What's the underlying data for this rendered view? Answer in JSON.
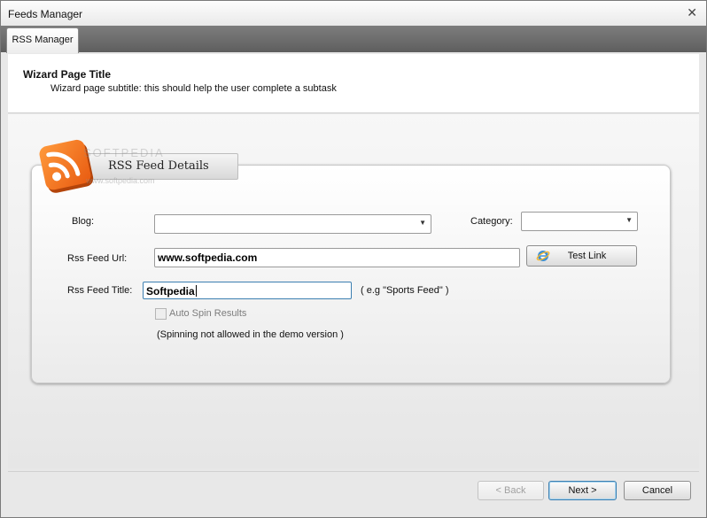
{
  "window": {
    "title": "Feeds Manager",
    "close_glyph": "✕"
  },
  "tabs": [
    {
      "label": "RSS Manager"
    }
  ],
  "header": {
    "title": "Wizard Page Title",
    "subtitle": "Wizard page subtitle: this should help the user complete a subtask"
  },
  "panel": {
    "badge_title": "RSS Feed Details",
    "watermark": "SOFTPEDIA",
    "watermark_url": "www.softpedia.com",
    "icon": "rss-icon",
    "fields": {
      "blog": {
        "label": "Blog:",
        "value": ""
      },
      "category": {
        "label": "Category:",
        "value": ""
      },
      "feed_url": {
        "label": "Rss Feed Url:",
        "value": "www.softpedia.com"
      },
      "feed_title": {
        "label": "Rss Feed Title:",
        "value": "Softpedia",
        "hint": "( e.g \"Sports Feed\" )"
      },
      "auto_spin": {
        "label": "Auto Spin Results",
        "checked": false,
        "enabled": false
      },
      "spin_note": "(Spinning not allowed in the demo version )"
    },
    "test_link_label": "Test Link"
  },
  "footer": {
    "back_label": "< Back",
    "next_label": "Next >",
    "cancel_label": "Cancel"
  },
  "colors": {
    "accent": "#3c7fb1",
    "rss_orange": "#f26f21"
  }
}
